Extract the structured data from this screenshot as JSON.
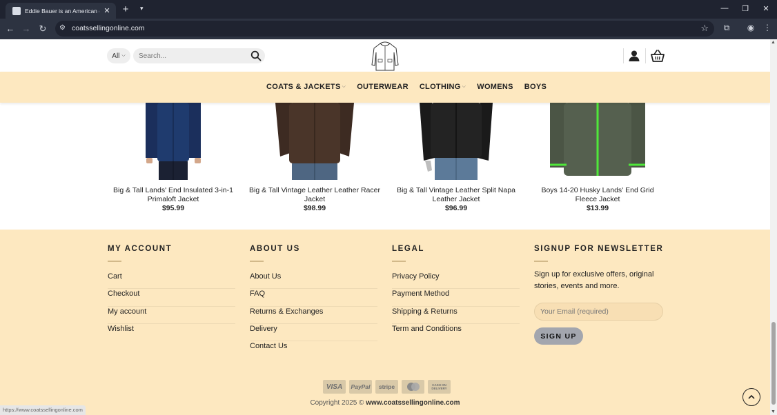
{
  "browser": {
    "tab_title": "Eddie Bauer is an American clothing",
    "url": "coatssellingonline.com"
  },
  "header": {
    "category_label": "All",
    "search_placeholder": "Search..."
  },
  "nav": {
    "coats": "COATS & JACKETS",
    "outerwear": "OUTERWEAR",
    "clothing": "CLOTHING",
    "womens": "WOMENS",
    "boys": "BOYS"
  },
  "products": [
    {
      "name": "Big & Tall Lands' End Insulated 3-in-1 Primaloft Jacket",
      "price": "$95.99",
      "color": "#1f3b6e"
    },
    {
      "name": "Big & Tall Vintage Leather Leather Racer Jacket",
      "price": "$98.99",
      "color": "#4a3529"
    },
    {
      "name": "Big & Tall Vintage Leather Split Napa Leather Jacket",
      "price": "$96.99",
      "color": "#232323"
    },
    {
      "name": "Boys 14-20 Husky Lands' End Grid Fleece Jacket",
      "price": "$13.99",
      "color": "#55604f"
    }
  ],
  "footer": {
    "account": {
      "heading": "MY ACCOUNT",
      "links": [
        "Cart",
        "Checkout",
        "My account",
        "Wishlist"
      ]
    },
    "about": {
      "heading": "ABOUT US",
      "links": [
        "About Us",
        "FAQ",
        "Returns & Exchanges",
        "Delivery",
        "Contact Us"
      ]
    },
    "legal": {
      "heading": "LEGAL",
      "links": [
        "Privacy Policy",
        "Payment Method",
        "Shipping & Returns",
        "Term and Conditions"
      ]
    },
    "newsletter": {
      "heading": "SIGNUP FOR NEWSLETTER",
      "text": "Sign up for exclusive offers, original stories, events and more.",
      "email_placeholder": "Your Email (required)",
      "button": "SIGN UP"
    },
    "payments": [
      "VISA",
      "PayPal",
      "stripe",
      "",
      "CASH ON DELIVERY"
    ],
    "copyright_prefix": "Copyright 2025 ©",
    "copyright_site": "www.coatssellingonline.com"
  },
  "status_url": "https://www.coatssellingonline.com",
  "colors": {
    "accent": "#fde8c0",
    "fleece_zip": "#4fe83a"
  }
}
